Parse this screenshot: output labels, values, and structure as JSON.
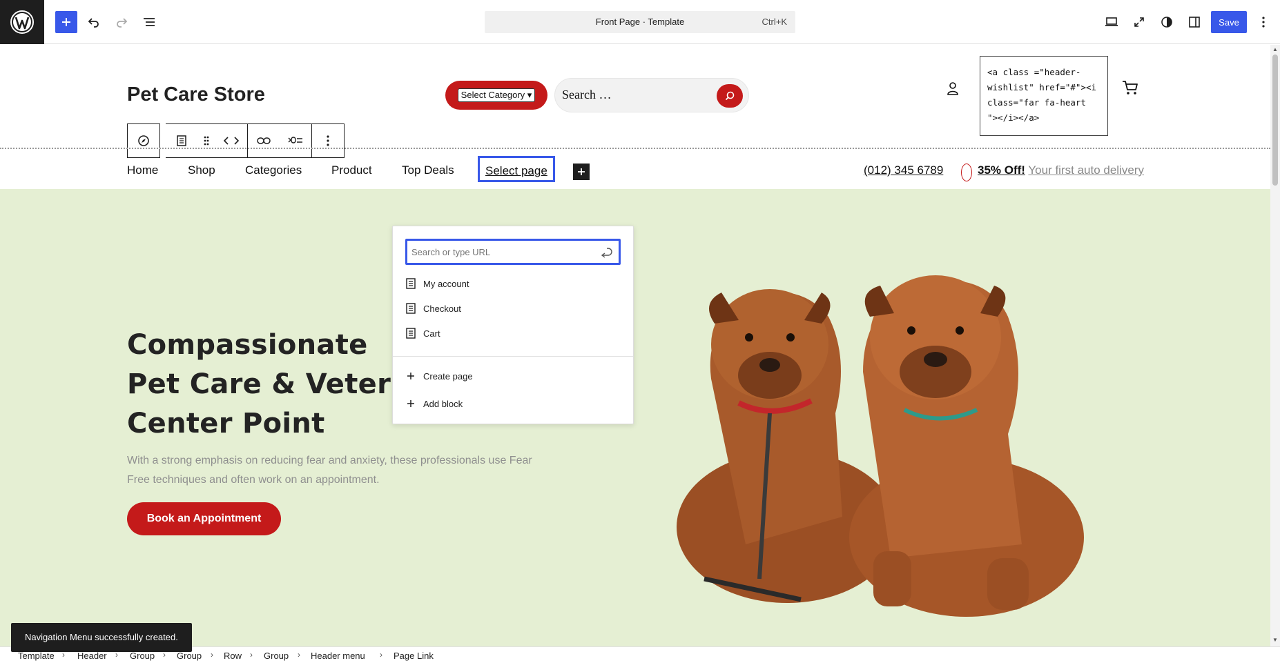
{
  "topbar": {
    "document_title": "Front Page · Template",
    "shortcut": "Ctrl+K",
    "save_label": "Save"
  },
  "site": {
    "title": "Pet Care Store",
    "category_select": "Select Category",
    "search_placeholder": "Search …",
    "code_snippet": "<a class =\"header-wishlist\" href=\"#\"><i class=\"far fa-heart \"></i></a>"
  },
  "nav": {
    "items": [
      "Home",
      "Shop",
      "Categories",
      "Product",
      "Top Deals"
    ],
    "selected_item": "Select page",
    "phone": "(012) 345 6789",
    "deal_bold": "35% Off!",
    "deal_link": "Your first auto delivery"
  },
  "link_popover": {
    "url_placeholder": "Search or type URL",
    "suggestions": [
      "My account",
      "Checkout",
      "Cart"
    ],
    "actions": [
      "Create page",
      "Add block"
    ]
  },
  "hero": {
    "title_lines": [
      "Compassionate",
      "Pet Care & Veterinary",
      "Center Point"
    ],
    "description": "With a strong emphasis on reducing fear and anxiety, these professionals use Fear Free techniques and often work on an appointment.",
    "button_label": "Book an Appointment"
  },
  "snackbar": {
    "message": "Navigation Menu successfully created."
  },
  "breadcrumb": [
    "Template",
    "Header",
    "Group",
    "Group",
    "Row",
    "Group",
    "Header menu",
    "Page Link"
  ],
  "colors": {
    "accent": "#3858e9",
    "brand_red": "#c41a1a",
    "hero_bg": "#e5efd3",
    "dark": "#1e1e1e"
  }
}
